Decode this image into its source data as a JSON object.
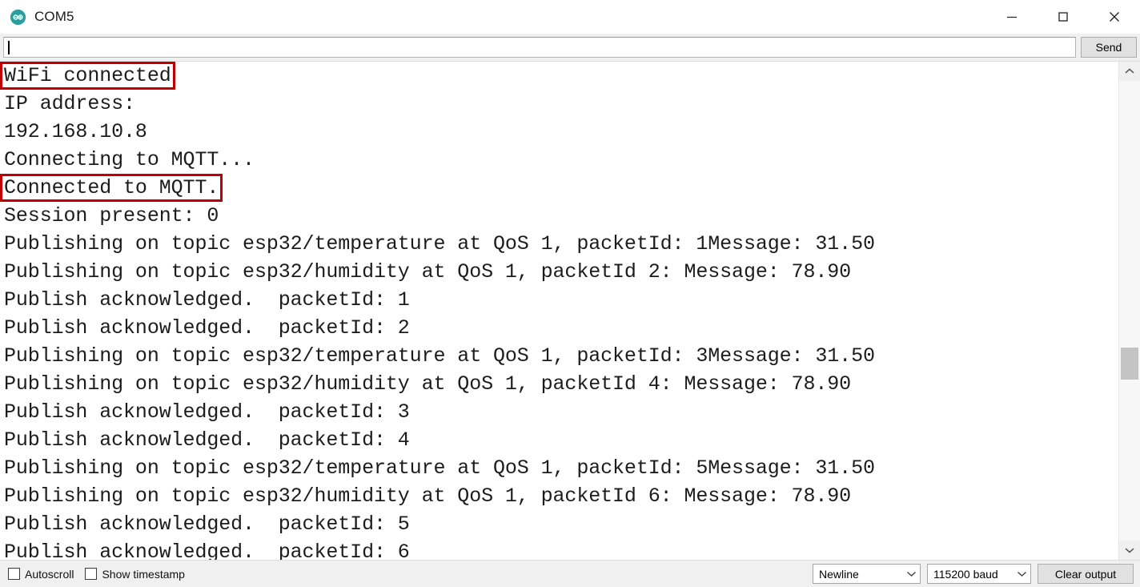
{
  "window": {
    "title": "COM5",
    "icon": "arduino-logo-icon",
    "accent_teal": "#2a9d9d",
    "controls": {
      "minimize": "minimize-icon",
      "maximize": "maximize-icon",
      "close": "close-icon"
    }
  },
  "send_row": {
    "input_value": "",
    "input_placeholder": "",
    "send_label": "Send"
  },
  "console": {
    "lines": [
      {
        "text": "WiFi connected",
        "highlight": true
      },
      {
        "text": "IP address: ",
        "highlight": false
      },
      {
        "text": "192.168.10.8",
        "highlight": false
      },
      {
        "text": "Connecting to MQTT...",
        "highlight": false
      },
      {
        "text": "Connected to MQTT.",
        "highlight": true
      },
      {
        "text": "Session present: 0",
        "highlight": false
      },
      {
        "text": "Publishing on topic esp32/temperature at QoS 1, packetId: 1Message: 31.50",
        "highlight": false
      },
      {
        "text": "Publishing on topic esp32/humidity at QoS 1, packetId 2: Message: 78.90",
        "highlight": false
      },
      {
        "text": "Publish acknowledged.  packetId: 1",
        "highlight": false
      },
      {
        "text": "Publish acknowledged.  packetId: 2",
        "highlight": false
      },
      {
        "text": "Publishing on topic esp32/temperature at QoS 1, packetId: 3Message: 31.50",
        "highlight": false
      },
      {
        "text": "Publishing on topic esp32/humidity at QoS 1, packetId 4: Message: 78.90",
        "highlight": false
      },
      {
        "text": "Publish acknowledged.  packetId: 3",
        "highlight": false
      },
      {
        "text": "Publish acknowledged.  packetId: 4",
        "highlight": false
      },
      {
        "text": "Publishing on topic esp32/temperature at QoS 1, packetId: 5Message: 31.50",
        "highlight": false
      },
      {
        "text": "Publishing on topic esp32/humidity at QoS 1, packetId 6: Message: 78.90",
        "highlight": false
      },
      {
        "text": "Publish acknowledged.  packetId: 5",
        "highlight": false
      },
      {
        "text": "Publish acknowledged.  packetId: 6",
        "highlight": false
      }
    ],
    "highlight_color": "#c00000"
  },
  "scrollbar": {
    "up_icon": "chevron-up-icon",
    "down_icon": "chevron-down-icon",
    "thumb_position_pct": 58
  },
  "statusbar": {
    "autoscroll_label": "Autoscroll",
    "autoscroll_checked": false,
    "timestamp_label": "Show timestamp",
    "timestamp_checked": false,
    "line_ending_value": "Newline",
    "baud_value": "115200 baud",
    "clear_label": "Clear output"
  }
}
